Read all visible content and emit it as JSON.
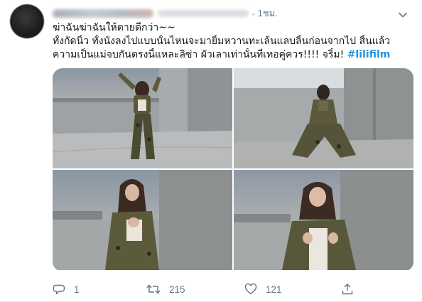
{
  "tweet": {
    "time": "1ชม.",
    "dot": "·",
    "text_line1": "ฆ่าฉันฆ่าฉันให้ตายดีกว่า~~",
    "text_line2": "ทั้งกัดนิ้ว ทั้งนั่งลงไปแบบนั้นไหนจะมายิ้มหวานทะเล้นแลบลิ้นก่อนจากไป สิ้นแล้ว",
    "text_line3_prefix": "ความเป็นแม่จบกันตรงนี้แหละลิซ่า ผัวเลาเท่านั้นที่เทอคู่ควร!!!! จริ้ม! ",
    "hashtag": "#lilifilm"
  },
  "icons": {
    "caret": "chevron-down-icon",
    "reply": "reply-icon",
    "retweet": "retweet-icon",
    "like": "heart-icon",
    "share": "share-icon"
  },
  "actions": {
    "reply_count": "1",
    "retweet_count": "215",
    "like_count": "121"
  },
  "colors": {
    "hashtag": "#1b95e0",
    "secondary_text": "#657786",
    "primary_text": "#14171a"
  }
}
